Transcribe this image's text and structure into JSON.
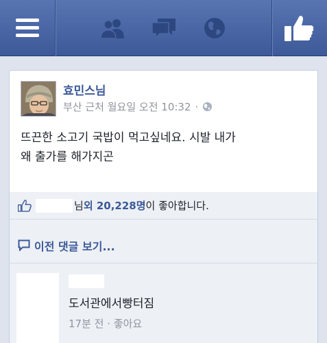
{
  "topbar": {
    "buttons": [
      {
        "name": "menu-button",
        "icon": "menu-icon"
      },
      {
        "name": "friend-requests-button",
        "icon": "friends-icon"
      },
      {
        "name": "messages-button",
        "icon": "messages-icon"
      },
      {
        "name": "notifications-button",
        "icon": "globe-icon"
      },
      {
        "name": "like-button",
        "icon": "thumbs-up-icon"
      }
    ],
    "colors": {
      "bar": "#3d5998",
      "icon_dim": "#2d4781",
      "icon_bright": "#ffffff"
    }
  },
  "post": {
    "author": "효민스님",
    "location_time": "부산 근처 월요일 오전 10:32",
    "separator": "·",
    "privacy_icon": "globe-icon",
    "text_line1": "뜨끈한 소고기 국밥이 먹고싶네요. 시발 내가",
    "text_line2": "왜 출가를 해가지곤"
  },
  "likes": {
    "icon": "thumbs-up-icon",
    "suffix_name": "님 ",
    "others_count": "외 20,228명",
    "suffix": "이 좋아합니다."
  },
  "comments": {
    "previous_label": "이전 댓글 보기...",
    "previous_icon": "comment-bubble-icon",
    "items": [
      {
        "text": "도서관에서빵터짐",
        "time": "17분 전",
        "separator": "·",
        "like_label": "좋아요"
      }
    ]
  }
}
